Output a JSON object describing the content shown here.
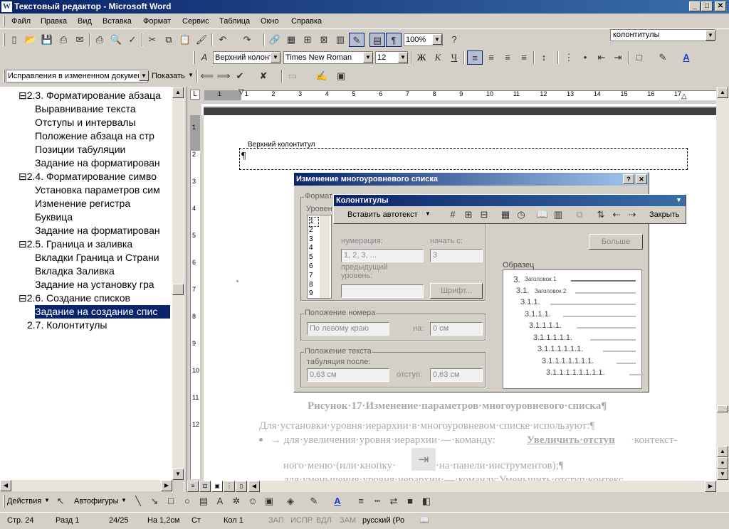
{
  "window": {
    "title": "Текстовый редактор - Microsoft Word",
    "icon": "W"
  },
  "menu": [
    "Файл",
    "Правка",
    "Вид",
    "Вставка",
    "Формат",
    "Сервис",
    "Таблица",
    "Окно",
    "Справка"
  ],
  "help_box": "колонтитулы",
  "standard_toolbar": {
    "zoom": "100%"
  },
  "format_toolbar": {
    "style": "Верхний колонт",
    "font": "Times New Roman",
    "size": "12",
    "bold": "Ж",
    "italic": "К",
    "underline": "Ч"
  },
  "review_toolbar": {
    "mode": "Исправления в измененном документ",
    "show": "Показать"
  },
  "doc_map": [
    {
      "text": "⊟2.3. Форматирование абзаца",
      "selected": false
    },
    {
      "text": "Выравнивание текста",
      "selected": false
    },
    {
      "text": "Отступы и интервалы",
      "selected": false
    },
    {
      "text": "Положение абзаца на стр",
      "selected": false
    },
    {
      "text": "Позиции табуляции",
      "selected": false
    },
    {
      "text": "Задание на форматирован",
      "selected": false
    },
    {
      "text": "⊟2.4. Форматирование симво",
      "selected": false
    },
    {
      "text": "Установка параметров сим",
      "selected": false
    },
    {
      "text": "Изменение регистра",
      "selected": false
    },
    {
      "text": "Буквица",
      "selected": false
    },
    {
      "text": "Задание на форматирован",
      "selected": false
    },
    {
      "text": "⊟2.5. Граница и заливка",
      "selected": false
    },
    {
      "text": "Вкладки Граница и Страни",
      "selected": false
    },
    {
      "text": "Вкладка Заливка",
      "selected": false
    },
    {
      "text": "Задание на установку гра",
      "selected": false
    },
    {
      "text": "⊟2.6. Создание списков",
      "selected": false
    },
    {
      "text": "Задание на создание спис",
      "selected": true
    },
    {
      "text": "2.7. Колонтитулы",
      "selected": false
    }
  ],
  "ruler_numbers": [
    "1",
    "1",
    "2",
    "3",
    "4",
    "5",
    "6",
    "7",
    "8",
    "9",
    "10",
    "11",
    "12",
    "13",
    "14",
    "15",
    "16",
    "17"
  ],
  "vruler_numbers": [
    "1",
    "2",
    "3",
    "4",
    "5",
    "6",
    "7",
    "8",
    "9",
    "10",
    "11",
    "12"
  ],
  "header_label": "Верхний колонтитул",
  "pilcrow": "¶",
  "dialog": {
    "title": "Изменение многоуровневого списка",
    "format_group": "Формат",
    "level_label": "Уровен",
    "levels": [
      "1",
      "2",
      "3",
      "4",
      "5",
      "6",
      "7",
      "8",
      "9"
    ],
    "numbering_label": "нумерация:",
    "numbering_value": "1, 2, 3, ...",
    "start_label": "начать с:",
    "start_value": "3",
    "prev_level_label": "предыдущий уровень:",
    "font_button": "Шрифт...",
    "more_button": "Больше",
    "sample_label": "Образец",
    "samples": [
      "3.",
      "3.1.",
      "3.1.1.",
      "3.1.1.1.",
      "3.1.1.1.1.",
      "3.1.1.1.1.1.",
      "3.1.1.1.1.1.1.",
      "3.1.1.1.1.1.1.1.",
      "3.1.1.1.1.1.1.1.1."
    ],
    "sample_heading1": "Заголовок 1",
    "sample_heading2": "Заголовок 2",
    "number_pos_group": "Положение номера",
    "number_pos_value": "По левому краю",
    "at_label": "на:",
    "at_value": "0 см",
    "text_pos_group": "Положение текста",
    "tab_after_label": "табуляция после:",
    "tab_after_value": "0,63 см",
    "indent_label": "отступ:",
    "indent_value": "0,63 см"
  },
  "hf_toolbar": {
    "title": "Колонтитулы",
    "insert_autotext": "Вставить автотекст",
    "close": "Закрыть"
  },
  "doc_lines": {
    "caption": "Рисунок·17·Изменение·параметров·многоуровневого·списка¶",
    "line1": "Для·установки·уровня·иерархии·в·многоуровневом·списке·используют:¶",
    "bullet1_pre": "→ для·увеличения·уровня·иерархии·—·команду:",
    "bullet1_bold": "Увеличить·отступ",
    "bullet1_post": "·контекст-",
    "line3_pre": "ного·меню·(или·кнопку·",
    "line3_post": "·на·панели·инструментов);¶",
    "line4": "для·уменьшения·уровня·иерархии·—·команду:Уменьшить·отступ·контекс"
  },
  "drawing_toolbar": {
    "actions": "Действия",
    "autoshapes": "Автофигуры"
  },
  "status": {
    "page": "Стр. 24",
    "section": "Разд 1",
    "pages": "24/25",
    "at": "На 1,2см",
    "line": "Ст",
    "col": "Кол 1",
    "rec": "ЗАП",
    "trk": "ИСПР",
    "ext": "ВДЛ",
    "ovr": "ЗАМ",
    "lang": "русский (Ро"
  }
}
